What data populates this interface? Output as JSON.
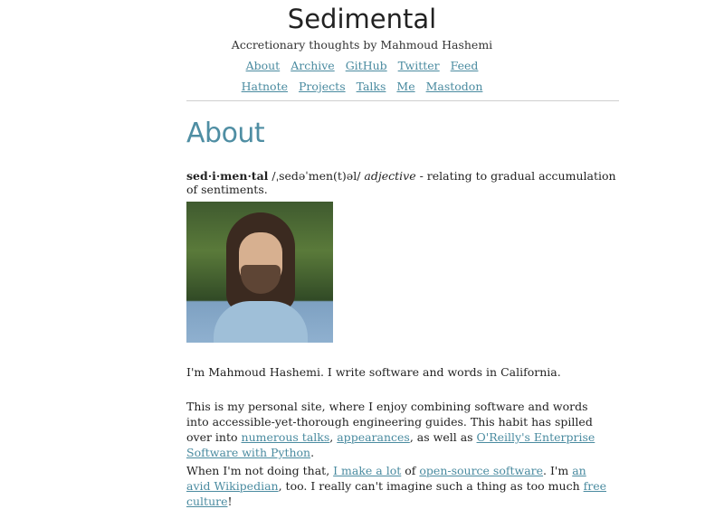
{
  "site": {
    "title": "Sedimental",
    "tagline": "Accretionary thoughts by Mahmoud Hashemi"
  },
  "nav": {
    "row1": [
      "About",
      "Archive",
      "GitHub",
      "Twitter",
      "Feed"
    ],
    "row2": [
      "Hatnote",
      "Projects",
      "Talks",
      "Me",
      "Mastodon"
    ]
  },
  "page": {
    "title": "About",
    "definition": {
      "word": "sed·i·men·tal",
      "pronunciation": "/ˌsedəˈmen(t)əl/",
      "part_of_speech": "adjective",
      "meaning": "- relating to gradual accumulation of sentiments."
    },
    "photo_alt": "Portrait photo",
    "para1": "I'm Mahmoud Hashemi. I write software and words in California.",
    "para2": {
      "t1": "This is my personal site, where I enjoy combining software and words into accessible-yet-thorough engineering guides. This habit has spilled over into ",
      "link1": "numerous talks",
      "t2": ", ",
      "link2": "appearances",
      "t3": ", as well as ",
      "link3": "O'Reilly's Enterprise Software with Python",
      "t4": "."
    },
    "para3": {
      "t1": "When I'm not doing that, ",
      "link1": "I make a lot",
      "t2": " of ",
      "link2": "open-source software",
      "t3": ". I'm ",
      "link3": "an avid Wikipedian",
      "t4": ", too. I really can't imagine such a thing as too much ",
      "link4": "free culture",
      "t5": "!"
    }
  },
  "colors": {
    "link": "#4a8ba0",
    "page_title": "#4f8ea3"
  }
}
